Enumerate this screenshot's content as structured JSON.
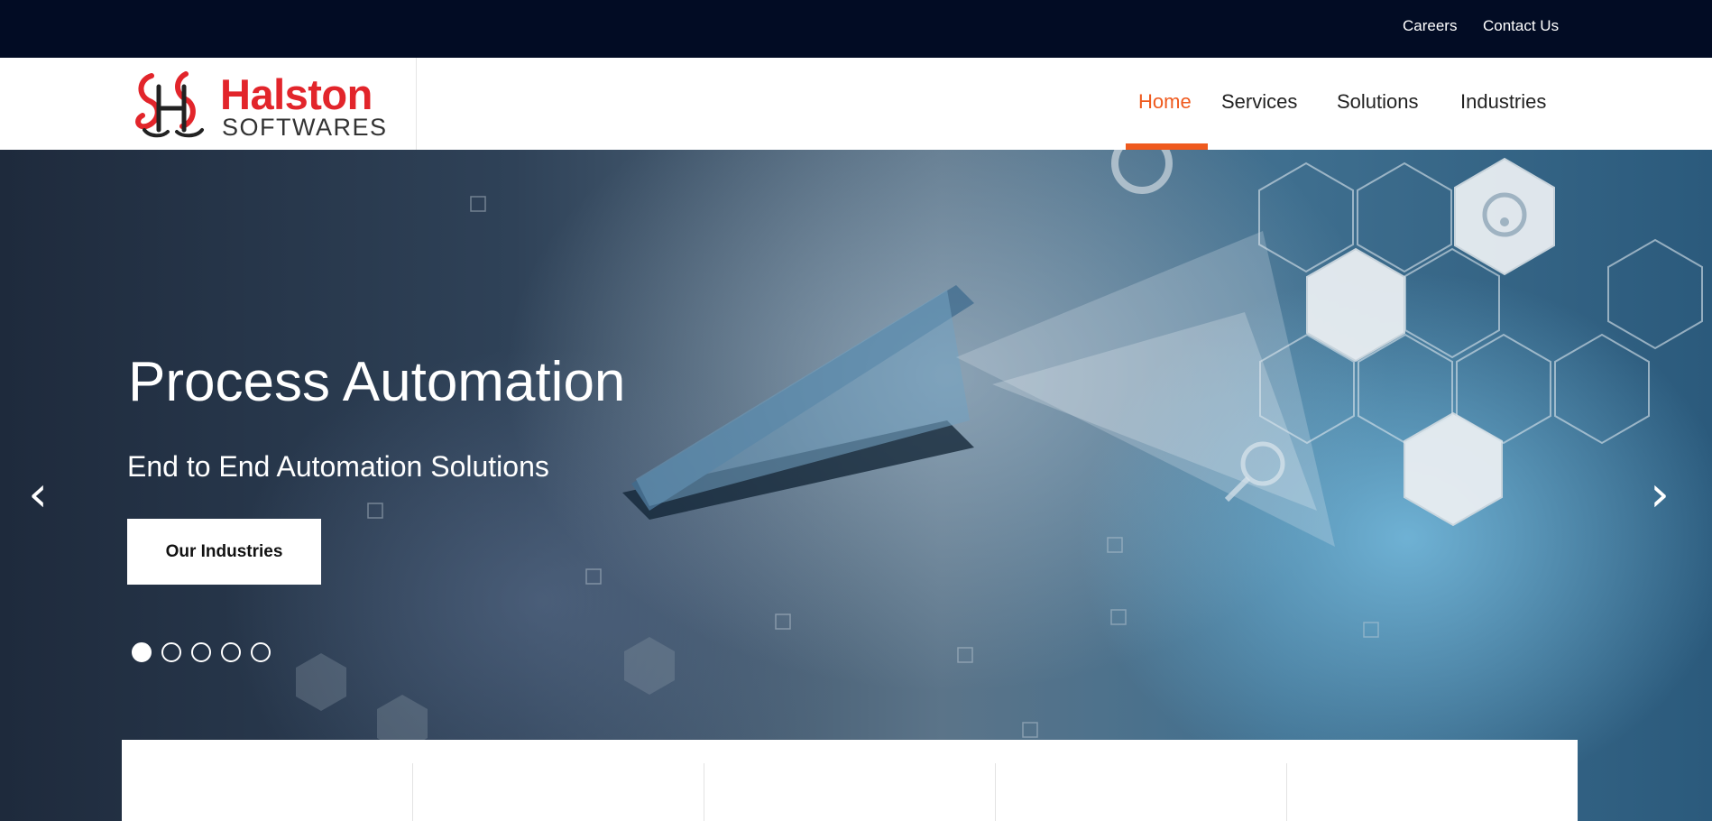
{
  "topbar": {
    "links": [
      {
        "label": "Careers"
      },
      {
        "label": "Contact Us"
      }
    ]
  },
  "brand": {
    "name": "Halston",
    "tagline": "SOFTWARES",
    "colors": {
      "primary": "#e2252b",
      "secondary": "#333333"
    }
  },
  "nav": {
    "items": [
      {
        "label": "Home",
        "active": true
      },
      {
        "label": "Services",
        "active": false
      },
      {
        "label": "Solutions",
        "active": false
      },
      {
        "label": "Industries",
        "active": false
      }
    ],
    "active_color": "#ef5a1e"
  },
  "hero": {
    "title": "Process Automation",
    "subtitle": "End to End Automation Solutions",
    "cta_label": "Our Industries",
    "prev_icon": "chevron-left-icon",
    "next_icon": "chevron-right-icon",
    "slides_total": 5,
    "active_slide": 1
  },
  "colors": {
    "topbar_bg": "#020c24",
    "accent": "#ef5a1e"
  }
}
